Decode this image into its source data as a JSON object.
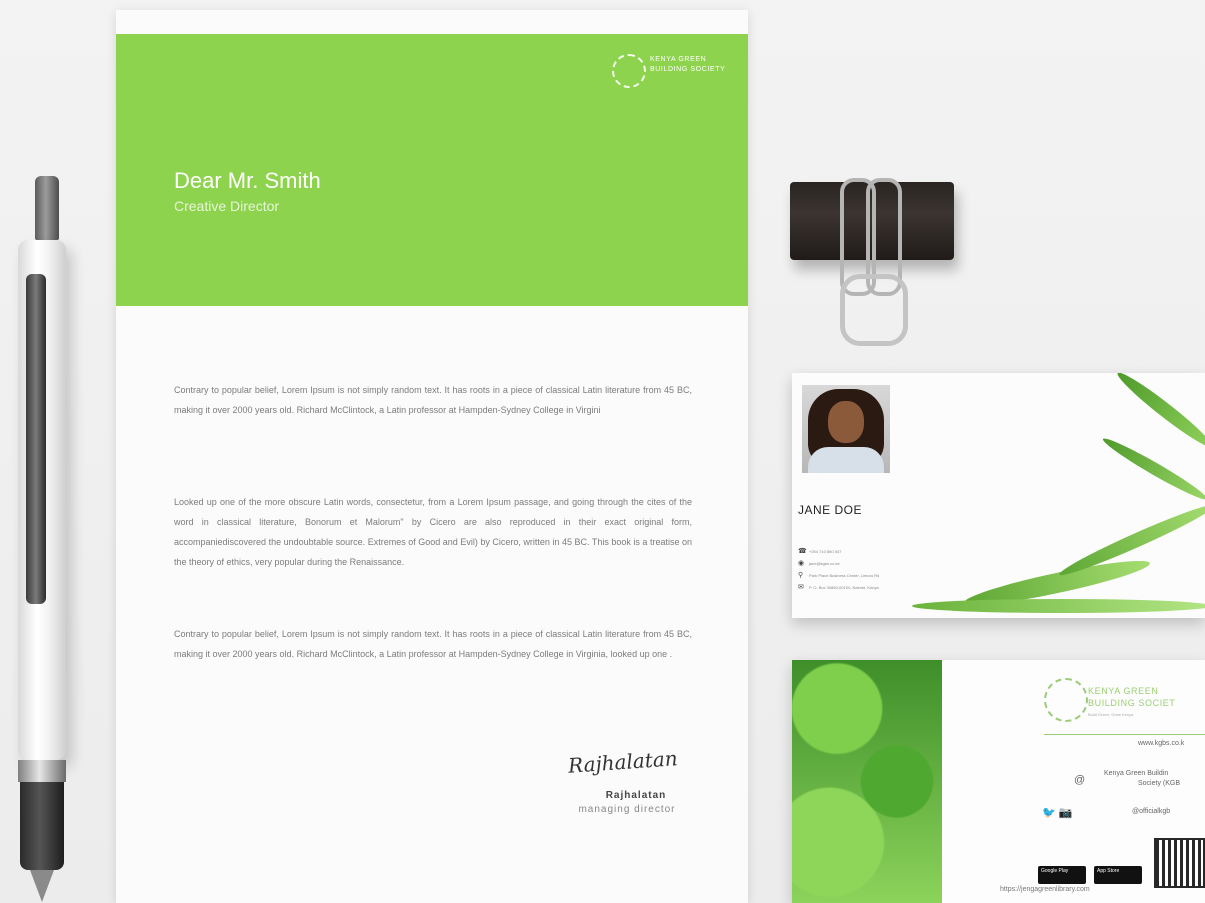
{
  "letter": {
    "logo_line1": "KENYA GREEN",
    "logo_line2": "BUILDING SOCIETY",
    "greeting": "Dear Mr. Smith",
    "role": "Creative Director",
    "paragraphs": [
      "Contrary to popular belief, Lorem Ipsum is not simply random text. It has roots in a piece of classical Latin literature from 45 BC, making it over 2000 years old. Richard McClintock, a Latin professor at Hampden-Sydney College in Virgini",
      "Looked up one of the more obscure Latin words, consectetur, from a Lorem Ipsum passage, and going through the cites of the word in classical literature, Bonorum et Malorum\" by Cicero are also reproduced in their exact original form, accompaniediscovered the undoubtable source. Extremes of Good and Evil) by Cicero, written in 45 BC. This book is a treatise on the theory of ethics, very popular during the Renaissance.",
      "Contrary to popular belief, Lorem Ipsum is not simply random text. It has roots in a piece of classical Latin literature from 45 BC, making it over 2000 years old. Richard McClintock, a Latin professor at Hampden-Sydney College in Virginia, looked up one ."
    ],
    "signature_script": "Rajhalatan",
    "signature_name": "Rajhalatan",
    "signature_title": "managing director"
  },
  "card_front": {
    "name": "JANE DOE",
    "contacts": [
      "+254 710 860 547",
      "jane@kgbs.co.ke",
      "Park Place Business Center, Limuru Rd",
      "P. O. Box 30860-00100, Nairobi, Kenya"
    ]
  },
  "card_back": {
    "org_line1": "KENYA GREEN",
    "org_line2": "BUILDING SOCIET",
    "tagline": "Build Green. Grow Kenya",
    "website": "www.kgbs.co.k",
    "org_full_line1": "Kenya Green Buildin",
    "org_full_line2": "Society (KGB",
    "at_symbol": "@",
    "social_icons": "🐦 📷",
    "social_handle": "@officialkgb",
    "google_play": "Google Play",
    "app_store": "App Store",
    "url": "https://jengagreenlibrary.com"
  },
  "colors": {
    "accent_green": "#8ed34e",
    "paper": "#fbfbfb"
  }
}
